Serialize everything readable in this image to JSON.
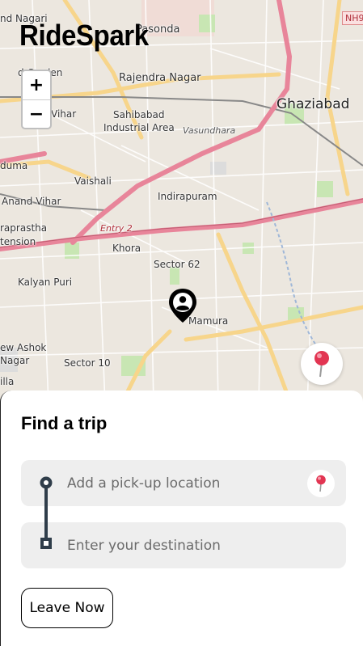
{
  "app": {
    "brand": "RideSpark"
  },
  "map": {
    "zoom_in_label": "+",
    "zoom_out_label": "−",
    "highway_shield": "NH9",
    "labels": {
      "nagari": "nd Nagari",
      "pasonda": "Pasonda",
      "garden": "d Garden",
      "rajendra": "Rajendra Nagar",
      "ghaziabad": "Ghaziabad",
      "vihar": "Vihar",
      "sahibabad": "Sahibabad",
      "industrial": "Industrial Area",
      "vasundhara": "Vasundhara",
      "duma": "duma",
      "vaishali": "Vaishali",
      "indirapuram": "Indirapuram",
      "anandvihar": "Anand Vihar",
      "raprastha": "raprastha",
      "tension": "tension",
      "entry2": "Entry 2",
      "khora": "Khora",
      "sector62": "Sector 62",
      "kalyanpuri": "Kalyan Puri",
      "mamura": "Mamura",
      "ewashok": "ew Ashok",
      "nagar": "Nagar",
      "sector10": "Sector 10",
      "illa": "illa"
    },
    "marker_icon": "user-location-pin-icon",
    "locate_icon": "red-pushpin-icon"
  },
  "panel": {
    "title": "Find a trip",
    "pickup": {
      "placeholder": "Add a pick-up location",
      "value": ""
    },
    "destination": {
      "placeholder": "Enter your destination",
      "value": ""
    },
    "leave_now_label": "Leave Now"
  },
  "colors": {
    "major_road": "#e8859a",
    "secondary_road": "#f7d58b",
    "minor_road": "#ffffff",
    "land": "#ece7df",
    "park": "#c8e6b3",
    "field_bg": "#eeeeee",
    "route_line": "#2f3d4a"
  }
}
